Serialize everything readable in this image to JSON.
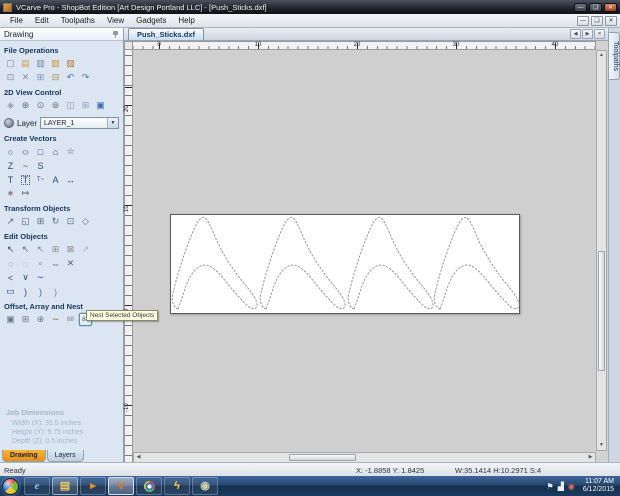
{
  "window": {
    "title": "VCarve Pro - ShopBot Edition [Art Design Portland LLC] - [Push_Sticks.dxf]",
    "controls": {
      "minimize": "—",
      "maximize": "❏",
      "close": "✕"
    }
  },
  "menu": {
    "items": [
      "File",
      "Edit",
      "Toolpaths",
      "View",
      "Gadgets",
      "Help"
    ]
  },
  "drawing_panel": {
    "header": "Drawing",
    "sections": {
      "file_operations": {
        "title": "File Operations",
        "rows": [
          [
            {
              "name": "new-file-icon",
              "g": "▢",
              "c": "#7a8894"
            },
            {
              "name": "open-file-icon",
              "g": "▤",
              "c": "#d79b3a"
            },
            {
              "name": "save-file-icon",
              "g": "▥",
              "c": "#6f87a6"
            },
            {
              "name": "import-vectors-icon",
              "g": "▧",
              "c": "#c9952f"
            },
            {
              "name": "export-vectors-icon",
              "g": "▨",
              "c": "#b87333"
            }
          ],
          [
            {
              "name": "job-setup-icon",
              "g": "⊡",
              "c": "#7a8894"
            },
            {
              "name": "cut-icon",
              "g": "✕",
              "c": "#8a8a8a"
            },
            {
              "name": "copy-icon",
              "g": "⊞",
              "c": "#7a8fae"
            },
            {
              "name": "paste-icon",
              "g": "⊟",
              "c": "#a88a4a"
            },
            {
              "name": "undo-icon",
              "g": "↶",
              "c": "#4a6fae"
            },
            {
              "name": "redo-icon",
              "g": "↷",
              "c": "#4a6fae"
            }
          ]
        ]
      },
      "view_control": {
        "title": "2D View Control",
        "rows": [
          [
            {
              "name": "pan-icon",
              "g": "◈",
              "c": "#8a9ab0"
            },
            {
              "name": "zoom-in-icon",
              "g": "⊕",
              "c": "#5a6a7a"
            },
            {
              "name": "zoom-box-icon",
              "g": "⊙",
              "c": "#5a6a7a"
            },
            {
              "name": "zoom-extents-icon",
              "g": "⊚",
              "c": "#5a6a7a"
            },
            {
              "name": "view-half-icon",
              "g": "◫",
              "c": "#8a9ab0"
            },
            {
              "name": "view-split-icon",
              "g": "⊞",
              "c": "#8a9ab0"
            },
            {
              "name": "view-3d-icon",
              "g": "▣",
              "c": "#3a6bb5"
            }
          ]
        ]
      },
      "create_vectors": {
        "title": "Create Vectors",
        "rows": [
          [
            {
              "name": "draw-circle-icon",
              "g": "○",
              "c": "#2c4a7c"
            },
            {
              "name": "draw-ellipse-icon",
              "g": "○",
              "c": "#2c4a7c",
              "cls": "wide"
            },
            {
              "name": "draw-rectangle-icon",
              "g": "□",
              "c": "#2c4a7c"
            },
            {
              "name": "draw-polygon-icon",
              "g": "⌂",
              "c": "#2c4a7c"
            },
            {
              "name": "draw-star-icon",
              "g": "☆",
              "c": "#2c4a7c"
            }
          ],
          [
            {
              "name": "draw-polyline-icon",
              "g": "Z",
              "c": "#2c4a7c"
            },
            {
              "name": "draw-arc-icon",
              "g": "~",
              "c": "#2c4a7c"
            },
            {
              "name": "draw-curve-icon",
              "g": "S",
              "c": "#2c4a7c"
            }
          ],
          [
            {
              "name": "draw-text-icon",
              "g": "T",
              "c": "#2c4a7c"
            },
            {
              "name": "text-box-icon",
              "g": "T",
              "c": "#2c4a7c",
              "cls": "boxed"
            },
            {
              "name": "text-on-curve-icon",
              "g": "T~",
              "c": "#2c4a7c"
            },
            {
              "name": "text-spacing-icon",
              "g": "A",
              "c": "#2c4a7c"
            },
            {
              "name": "dimension-icon",
              "g": "↔",
              "c": "#2c4a7c"
            }
          ],
          [
            {
              "name": "freehand-draw-icon",
              "g": "∗",
              "c": "#8a5a8a"
            },
            {
              "name": "measure-icon",
              "g": "↦",
              "c": "#5a6a7a"
            }
          ]
        ]
      },
      "transform_objects": {
        "title": "Transform Objects",
        "rows": [
          [
            {
              "name": "move-icon",
              "g": "↗",
              "c": "#5a6a7a"
            },
            {
              "name": "set-position-icon",
              "g": "◱",
              "c": "#5a6a7a"
            },
            {
              "name": "align-icon",
              "g": "⊞",
              "c": "#5a6a7a"
            },
            {
              "name": "rotate-icon",
              "g": "↻",
              "c": "#5a6a7a"
            },
            {
              "name": "scale-icon",
              "g": "⊡",
              "c": "#5a6a7a"
            },
            {
              "name": "distort-icon",
              "g": "◇",
              "c": "#5a6a7a"
            }
          ]
        ]
      },
      "edit_objects": {
        "title": "Edit Objects",
        "rows": [
          [
            {
              "name": "select-icon",
              "g": "↖",
              "c": "#2c4a7c"
            },
            {
              "name": "node-edit-icon",
              "g": "↖",
              "c": "#4a6a9a"
            },
            {
              "name": "interactive-select-icon",
              "g": "↖",
              "c": "#7a8a9a"
            },
            {
              "name": "group-icon",
              "g": "⊞",
              "c": "#8a8a8a"
            },
            {
              "name": "ungroup-icon",
              "g": "⊠",
              "c": "#8a8a8a"
            },
            {
              "name": "snap-icon",
              "g": "↗",
              "c": "#b0b0b0"
            }
          ],
          [
            {
              "name": "weld-icon",
              "g": "◌",
              "c": "#2c4a7c"
            },
            {
              "name": "trim-icon",
              "g": "◌",
              "c": "#6a7a9a"
            },
            {
              "name": "fillet-icon",
              "g": "∘",
              "c": "#8a8a8a"
            },
            {
              "name": "stretch-icon",
              "g": "⇔",
              "c": "#2c4a7c"
            },
            {
              "name": "delete-icon",
              "g": "✕",
              "c": "#55606a"
            }
          ],
          [
            {
              "name": "join-open-vectors-icon",
              "g": "<",
              "c": "#2c4a7c"
            },
            {
              "name": "close-vector-icon",
              "g": "∨",
              "c": "#2c4a7c"
            },
            {
              "name": "fit-curve-icon",
              "g": "∼",
              "c": "#2c4a7c"
            }
          ],
          [
            {
              "name": "edit-rectangle-icon",
              "g": "▭",
              "c": "#2c4a7c"
            },
            {
              "name": "arc-fit-icon",
              "g": ")",
              "c": "#2c4a7c"
            },
            {
              "name": "bezier-fit-icon",
              "g": ")",
              "c": "#4a6a9a"
            },
            {
              "name": "line-fit-icon",
              "g": ")",
              "c": "#7a8a9a"
            }
          ]
        ]
      },
      "offset_array_nest": {
        "title": "Offset, Array and Nest",
        "rows": [
          [
            {
              "name": "offset-icon",
              "g": "▣",
              "c": "#6a7a8a"
            },
            {
              "name": "array-copy-icon",
              "g": "⊞",
              "c": "#6a7a8a"
            },
            {
              "name": "circular-array-icon",
              "g": "⊕",
              "c": "#6a7a8a"
            },
            {
              "name": "copy-along-vector-icon",
              "g": "∼",
              "c": "#8a6a4a"
            },
            {
              "name": "block-array-icon",
              "g": "88",
              "c": "#6a7a8a"
            },
            {
              "name": "nest-objects-icon",
              "g": "88",
              "c": "#2c4a7c",
              "cls": "hl"
            }
          ]
        ]
      }
    },
    "layer": {
      "label": "Layer",
      "value": "LAYER_1"
    },
    "job_dimensions": {
      "title": "Job Dimensions",
      "lines": [
        "Width (X): 35.5 inches",
        "Height (Y): 9.75 inches",
        "Depth (Z): 0.5 inches"
      ]
    },
    "tabs": [
      {
        "label": "Drawing",
        "active": true
      },
      {
        "label": "Layers",
        "active": false
      }
    ]
  },
  "document": {
    "tab": "Push_Sticks.dxf",
    "side_tab": "Toolpaths",
    "ruler_x": [
      "0",
      "10",
      "20",
      "30",
      "40"
    ],
    "ruler_y": [
      "20",
      "10",
      "0",
      "-10"
    ],
    "push_stick_offsets": [
      0,
      88,
      176,
      262
    ],
    "outline_color": "#9a8f95"
  },
  "tooltip": "Nest Selected Objects",
  "status_bar": {
    "ready": "Ready",
    "cursor": "X: -1.8858 Y: 1.8425",
    "selection": "W:35.1414 H:10.2971 S:4"
  },
  "taskbar": {
    "apps": [
      {
        "name": "taskbar-ie",
        "cls": "tb-ie",
        "g": "e"
      },
      {
        "name": "taskbar-explorer",
        "cls": "tb-explorer open",
        "g": "▤"
      },
      {
        "name": "taskbar-mediaplayer",
        "cls": "tb-mediaplayer",
        "g": "▸"
      },
      {
        "name": "taskbar-vcarve",
        "cls": "tb-vcarve active",
        "g": "V"
      },
      {
        "name": "taskbar-chrome",
        "cls": "tb-chrome",
        "g": ""
      },
      {
        "name": "taskbar-lightning-app",
        "cls": "tb-lightning",
        "g": "ϟ"
      },
      {
        "name": "taskbar-gray-app",
        "cls": "tb-grayapp",
        "g": "◉"
      }
    ],
    "tray": [
      {
        "name": "tray-flag-icon",
        "g": "⚑",
        "cls": ""
      },
      {
        "name": "tray-network-icon",
        "g": "▟",
        "cls": ""
      },
      {
        "name": "tray-alert-icon",
        "g": "◉",
        "cls": "red"
      }
    ],
    "clock_time": "11:07 AM",
    "clock_date": "6/12/2015"
  }
}
